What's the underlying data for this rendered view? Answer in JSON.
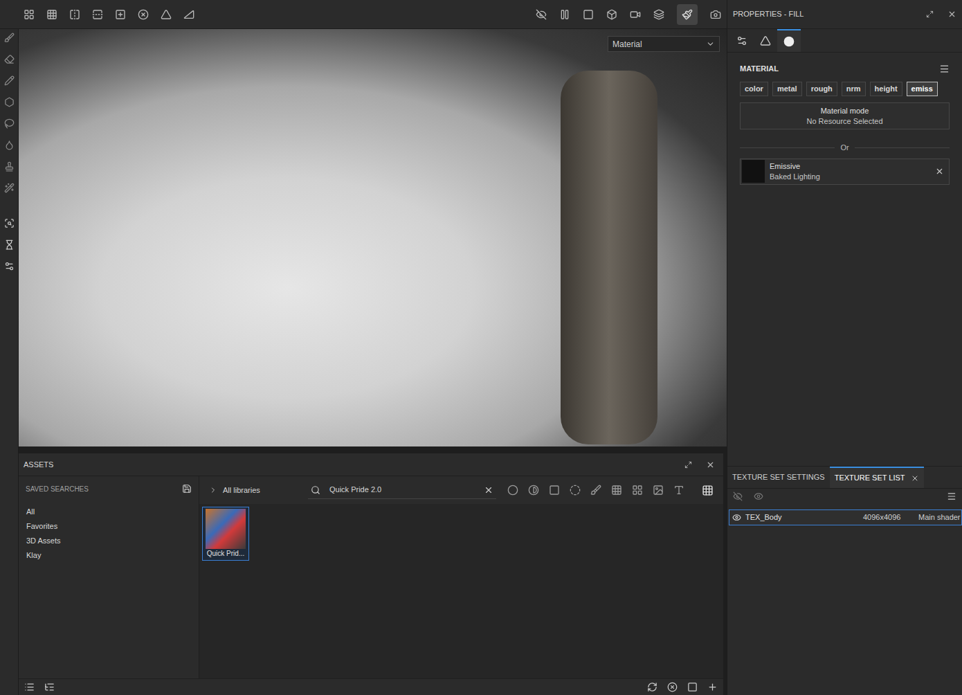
{
  "panel": {
    "title": "PROPERTIES - FILL"
  },
  "viewport": {
    "channel_dropdown": "Material"
  },
  "material": {
    "title": "MATERIAL",
    "channels": [
      {
        "label": "color",
        "selected": false
      },
      {
        "label": "metal",
        "selected": false
      },
      {
        "label": "rough",
        "selected": false
      },
      {
        "label": "nrm",
        "selected": false
      },
      {
        "label": "height",
        "selected": false
      },
      {
        "label": "emiss",
        "selected": true
      }
    ],
    "material_mode": {
      "title": "Material mode",
      "value": "No Resource Selected"
    },
    "divider": "Or",
    "resource": {
      "name": "Emissive",
      "subtitle": "Baked Lighting"
    }
  },
  "texture_sets": {
    "tabs": [
      {
        "label": "TEXTURE SET SETTINGS",
        "selected": false
      },
      {
        "label": "TEXTURE SET LIST",
        "selected": true
      }
    ],
    "rows": [
      {
        "name": "TEX_Body",
        "resolution": "4096x4096",
        "shader": "Main shader",
        "visible": true,
        "selected": true
      }
    ]
  },
  "assets": {
    "title": "ASSETS",
    "saved_searches": {
      "title": "SAVED SEARCHES",
      "items": [
        "All",
        "Favorites",
        "3D Assets",
        "Klay"
      ]
    },
    "breadcrumb": "All libraries",
    "search": {
      "value": "Quick Pride 2.0"
    },
    "items": [
      {
        "label": "Quick Prid...",
        "selected": true
      }
    ]
  }
}
